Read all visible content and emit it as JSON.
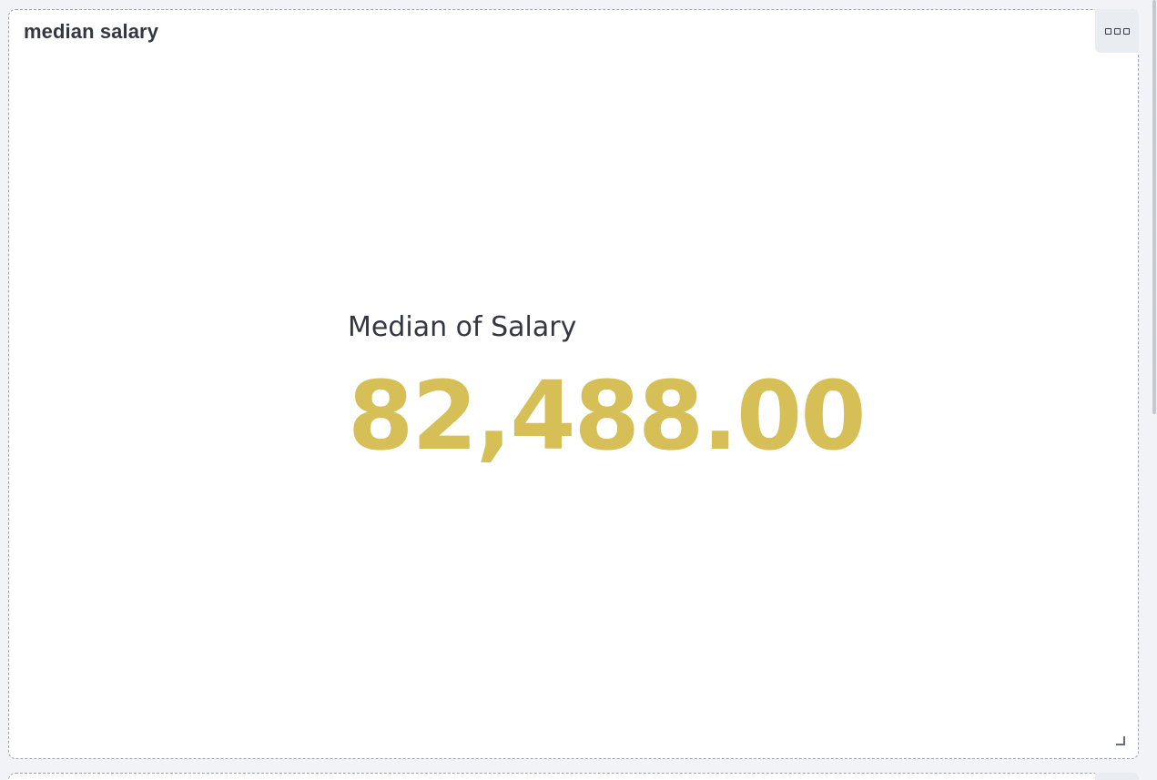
{
  "panel": {
    "title": "median salary",
    "menu_icon": "ellipsis-boxes-icon",
    "resize_icon": "resize-corner-icon"
  },
  "metric": {
    "label": "Median of Salary",
    "value": "82,488.00"
  },
  "colors": {
    "metric_value": "#d6bf57",
    "text": "#343741",
    "panel_border": "#98a2b3",
    "background": "#f1f3f6"
  }
}
